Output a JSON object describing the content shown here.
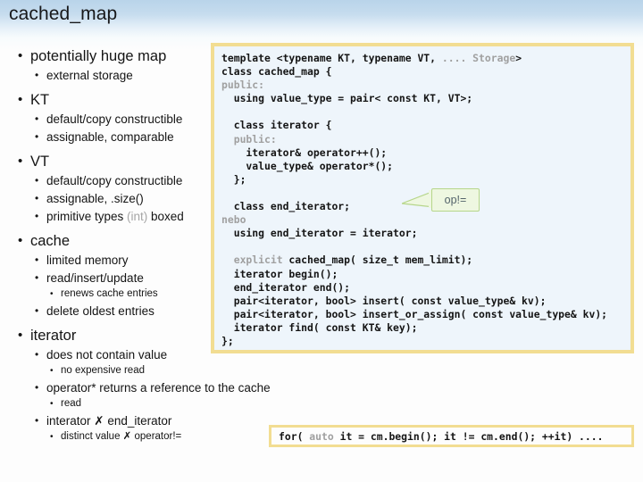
{
  "slide": {
    "title": "cached_map",
    "title_band_color_top": "#b9d4ea",
    "title_band_color_bottom": "#f7fbfd",
    "background": "#fdfdfd"
  },
  "bullets": [
    {
      "level": 1,
      "text": "potentially huge map"
    },
    {
      "level": 2,
      "text": "external storage"
    },
    {
      "level": 1,
      "text": "KT"
    },
    {
      "level": 2,
      "text": "default/copy constructible"
    },
    {
      "level": 2,
      "text": "assignable, comparable"
    },
    {
      "level": 1,
      "text": "VT"
    },
    {
      "level": 2,
      "text": "default/copy constructible"
    },
    {
      "level": 2,
      "text": "assignable, .size()"
    },
    {
      "level": 2,
      "text": "primitive types ",
      "gray": "(int)",
      "text_after": " boxed"
    },
    {
      "level": 1,
      "text": "cache"
    },
    {
      "level": 2,
      "text": "limited memory"
    },
    {
      "level": 2,
      "text": "read/insert/update"
    },
    {
      "level": 3,
      "text": "renews cache entries"
    },
    {
      "level": 2,
      "text": "delete oldest entries"
    },
    {
      "level": 1,
      "text": "iterator"
    },
    {
      "level": 2,
      "text": "does not contain value"
    },
    {
      "level": 3,
      "text": "no expensive read"
    },
    {
      "level": 2,
      "text": "operator* returns a reference to the cache"
    },
    {
      "level": 3,
      "text": "read"
    },
    {
      "level": 2,
      "text": "interator ✗ end_iterator"
    },
    {
      "level": 3,
      "text": "distinct value ✗ operator!="
    }
  ],
  "bullet_glyph": "•",
  "code_box": {
    "border_color": "#f2dd92",
    "background": "#eef5fb",
    "gray_keyword_color": "#a0a0a0",
    "lines": [
      [
        {
          "t": "template <typename KT, typename VT, "
        },
        {
          "t": ".... Storage",
          "gray": true
        },
        {
          "t": ">"
        }
      ],
      [
        {
          "t": "class cached_map {"
        }
      ],
      [
        {
          "t": "public:",
          "gray": true
        }
      ],
      [
        {
          "t": "  using value_type = pair< const KT, VT>;"
        }
      ],
      [
        {
          "t": ""
        }
      ],
      [
        {
          "t": "  class iterator {"
        }
      ],
      [
        {
          "t": "  public:",
          "gray": true
        }
      ],
      [
        {
          "t": "    iterator& operator++();"
        }
      ],
      [
        {
          "t": "    value_type& operator*();"
        }
      ],
      [
        {
          "t": "  };"
        }
      ],
      [
        {
          "t": ""
        }
      ],
      [
        {
          "t": "  class end_iterator;"
        }
      ],
      [
        {
          "t": "nebo",
          "gray": true
        }
      ],
      [
        {
          "t": "  using end_iterator = iterator;"
        }
      ],
      [
        {
          "t": ""
        }
      ],
      [
        {
          "t": "  explicit",
          "gray": true
        },
        {
          "t": " cached_map( size_t mem_limit);"
        }
      ],
      [
        {
          "t": "  iterator begin();"
        }
      ],
      [
        {
          "t": "  end_iterator end();"
        }
      ],
      [
        {
          "t": "  pair<iterator, bool> insert( const value_type& kv);"
        }
      ],
      [
        {
          "t": "  pair<iterator, bool> insert_or_assign( const value_type& kv);"
        }
      ],
      [
        {
          "t": "  iterator find( const KT& key);"
        }
      ],
      [
        {
          "t": "};"
        }
      ]
    ]
  },
  "callout": {
    "label": "op!=",
    "fill": "#eef7e1",
    "border": "#b6d68a"
  },
  "bottom_code": {
    "border_color": "#f2dd92",
    "background": "#fdfdfd",
    "lines": [
      [
        {
          "t": "for( "
        },
        {
          "t": "auto",
          "gray": true
        },
        {
          "t": " it = cm.begin(); it != cm.end(); ++it) ...."
        }
      ]
    ]
  }
}
